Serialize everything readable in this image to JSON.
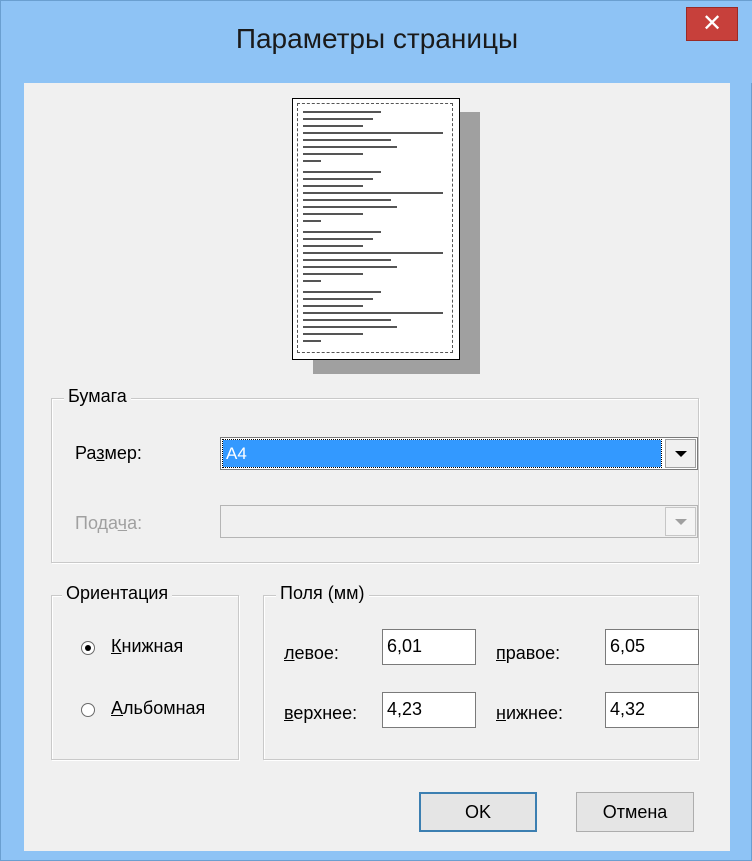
{
  "window": {
    "title": "Параметры страницы",
    "close_symbol": "✕"
  },
  "paper_group": {
    "legend": "Бумага",
    "size_label_pre": "Ра",
    "size_label_key": "з",
    "size_label_post": "мер:",
    "size_value": "A4",
    "source_label_pre": "Пода",
    "source_label_key": "ч",
    "source_label_post": "а:",
    "source_value": ""
  },
  "orientation_group": {
    "legend": "Ориентация",
    "portrait_key": "К",
    "portrait_rest": "нижная",
    "landscape_key": "А",
    "landscape_rest": "льбомная",
    "selected": "portrait"
  },
  "margins_group": {
    "legend": "Поля (мм)",
    "left_key": "л",
    "left_rest": "евое:",
    "left_value": "6,01",
    "right_key": "п",
    "right_rest": "равое:",
    "right_value": "6,05",
    "top_key": "в",
    "top_rest": "ерхнее:",
    "top_value": "4,23",
    "bottom_key": "н",
    "bottom_rest": "ижнее:",
    "bottom_value": "4,32"
  },
  "buttons": {
    "ok": "OK",
    "cancel": "Отмена"
  },
  "colors": {
    "titlebar": "#8ec3f5",
    "close": "#c7403b",
    "selection": "#3399ff"
  }
}
